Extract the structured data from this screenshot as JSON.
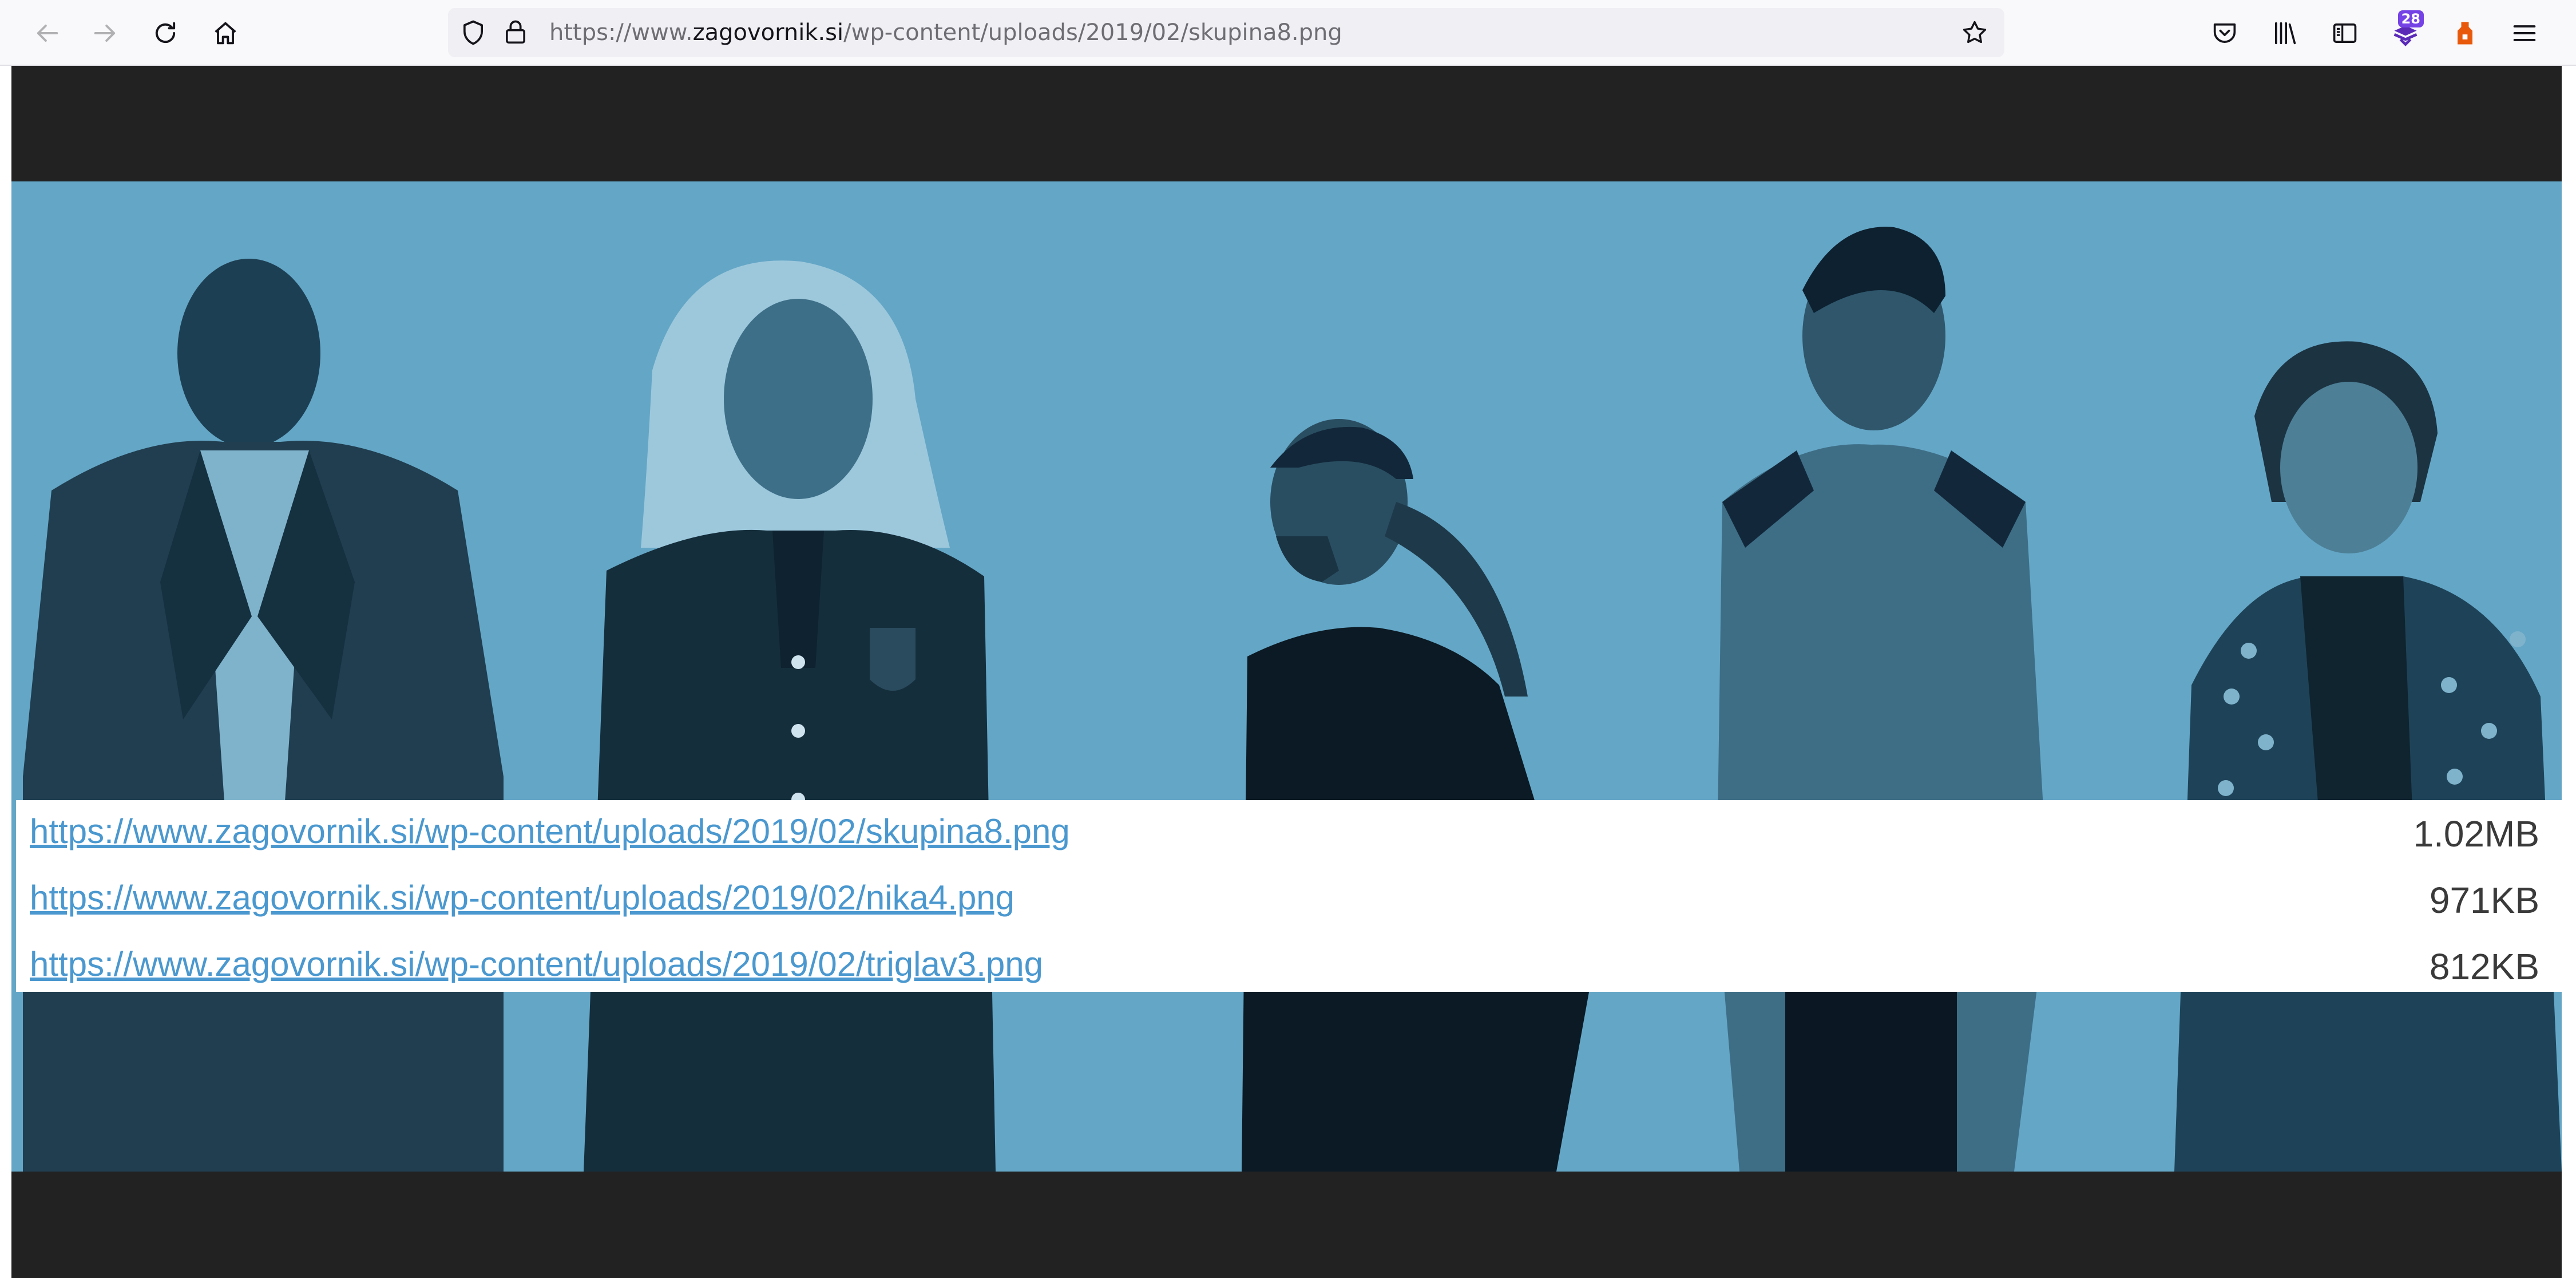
{
  "browser": {
    "url_prefix": "https://www.",
    "url_host": "zagovornik.si",
    "url_path": "/wp-content/uploads/2019/02/skupina8.png",
    "extension_badge_count": "28",
    "icons": {
      "back": "back-arrow-icon",
      "forward": "forward-arrow-icon",
      "reload": "reload-icon",
      "home": "home-icon",
      "shield": "tracking-protection-shield-icon",
      "lock": "padlock-icon",
      "bookmark": "bookmark-star-icon",
      "pocket": "pocket-icon",
      "library": "library-icon",
      "sidebar": "sidebar-icon",
      "extension": "image-download-extension-icon",
      "extension2": "orange-extension-icon",
      "menu": "hamburger-menu-icon"
    }
  },
  "colors": {
    "image_background": "#64a6c6",
    "link": "#4a98cf",
    "page_background": "#222222"
  },
  "links": [
    {
      "url": "https://www.zagovornik.si/wp-content/uploads/2019/02/skupina8.png",
      "size": "1.02MB"
    },
    {
      "url": "https://www.zagovornik.si/wp-content/uploads/2019/02/nika4.png",
      "size": "971KB"
    },
    {
      "url": "https://www.zagovornik.si/wp-content/uploads/2019/02/triglav3.png",
      "size": "812KB"
    }
  ]
}
